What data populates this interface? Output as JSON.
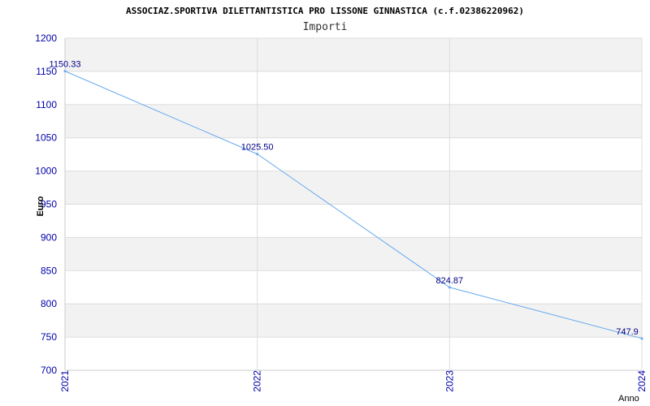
{
  "chart_data": {
    "type": "line",
    "title": "ASSOCIAZ.SPORTIVA DILETTANTISTICA PRO LISSONE GINNASTICA (c.f.02386220962)",
    "subtitle": "Importi",
    "xlabel": "Anno",
    "ylabel": "Euro",
    "categories": [
      "2021",
      "2022",
      "2023",
      "2024"
    ],
    "series": [
      {
        "values": [
          1150.33,
          1025.5,
          824.87,
          747.9
        ]
      }
    ],
    "data_labels": [
      "1150.33",
      "1025.50",
      "824.87",
      "747.9"
    ],
    "ylim": [
      700,
      1200
    ],
    "yticks": [
      700,
      750,
      800,
      850,
      900,
      950,
      1000,
      1050,
      1100,
      1150,
      1200
    ],
    "grid": true,
    "colors": {
      "line": "#66aaee",
      "band": "#f2f2f2",
      "grid": "#dddddd",
      "tick_text": "#0000aa",
      "label_text": "#000088"
    }
  }
}
